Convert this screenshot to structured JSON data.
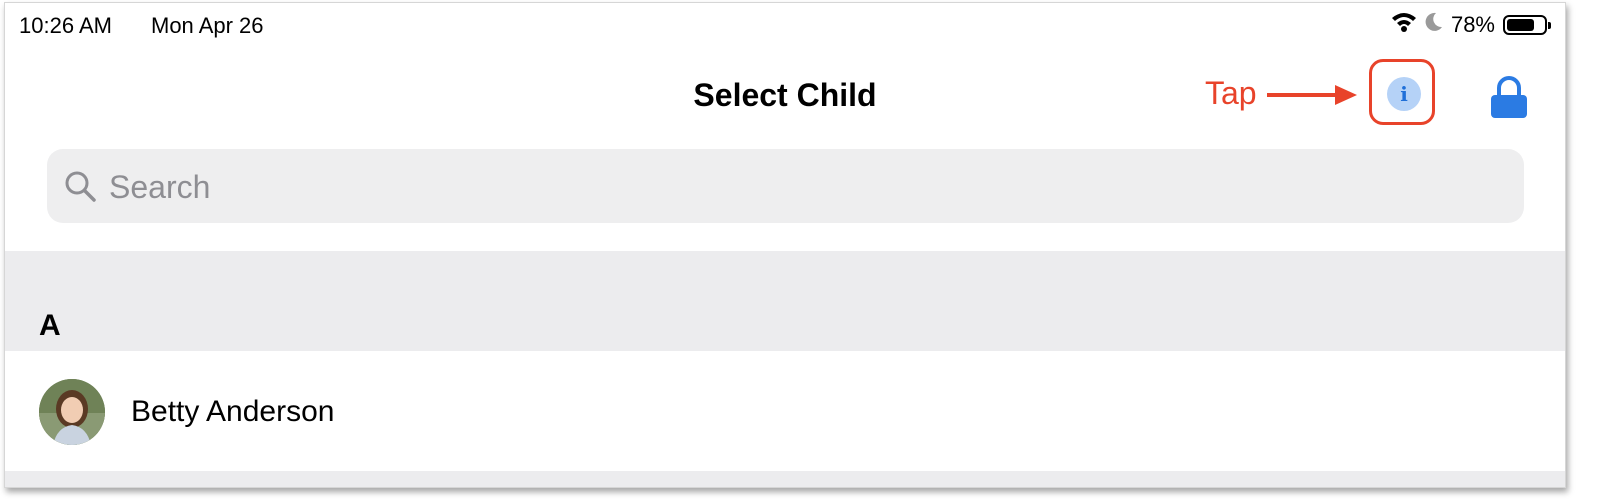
{
  "status_bar": {
    "time": "10:26 AM",
    "date": "Mon Apr 26",
    "battery_percent": "78%",
    "battery_level": 0.78,
    "icons": [
      "wifi-icon",
      "moon-icon",
      "battery-icon"
    ]
  },
  "nav": {
    "title": "Select Child",
    "annotation": "Tap",
    "info_icon_glyph": "i",
    "info_icon": "info-icon",
    "lock_icon": "lock-icon"
  },
  "search": {
    "placeholder": "Search",
    "value": ""
  },
  "list": {
    "sections": [
      {
        "header": "A",
        "items": [
          {
            "name": "Betty Anderson",
            "avatar": "child-photo"
          }
        ]
      }
    ]
  },
  "colors": {
    "accent_blue": "#1f6fd8",
    "annotation_red": "#e8432a",
    "section_bg": "#ececee",
    "search_bg": "#eeeeef"
  }
}
